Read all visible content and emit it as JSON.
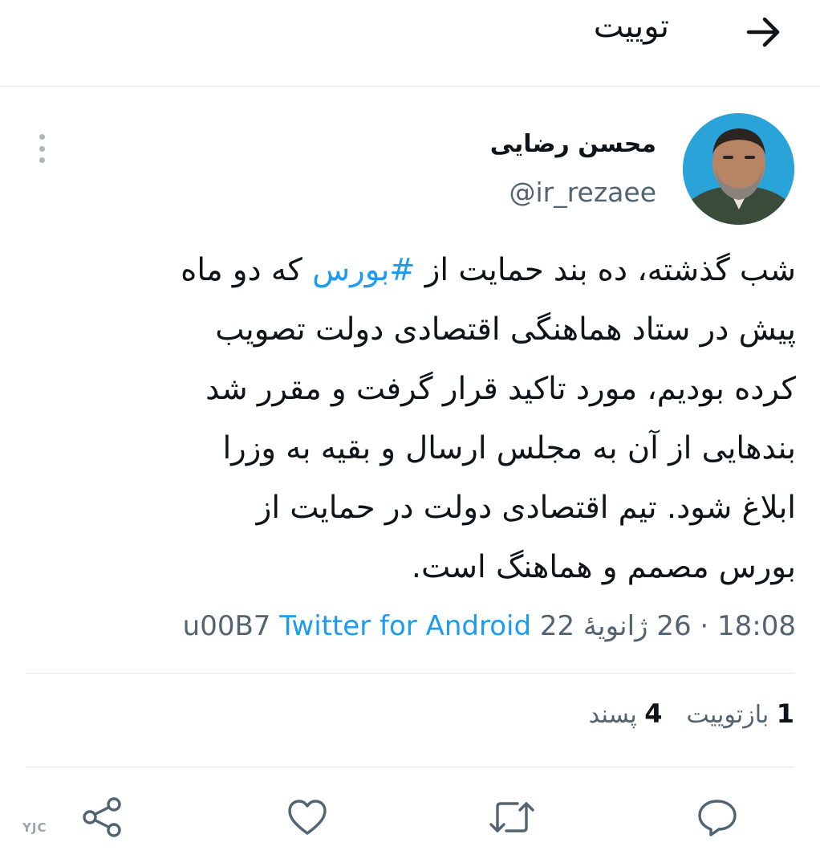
{
  "header": {
    "title": "توییت",
    "back_icon": "arrow-right-icon"
  },
  "author": {
    "name": "محسن رضایی",
    "handle": "@ir_rezaee",
    "avatar_bg": "#2aa3d8"
  },
  "tweet": {
    "line1_pre": "شب گذشته، ده بند حمایت از ",
    "hashtag": "#بورس",
    "line1_post": " که دو ماه",
    "line2": "پیش در ستاد هماهنگی اقتصادی دولت تصویب",
    "line3": "کرده بودیم، مورد تاکید قرار گرفت و مقرر شد",
    "line4": "بندهایی از آن به مجلس ارسال و بقیه به وزرا",
    "line5": "ابلاغ شود. تیم اقتصادی دولت در حمایت از",
    "line6": "بورس مصمم و هماهنگ است."
  },
  "meta": {
    "time": "18:08",
    "separator": "·",
    "date": "26 ژانویهٔ 22",
    "glyph": "u00B7",
    "source": "Twitter for Android"
  },
  "stats": {
    "retweets_count": "1",
    "retweets_label": "بازتوییت",
    "likes_count": "4",
    "likes_label": "پسند"
  },
  "actions": {
    "reply_icon": "reply-icon",
    "retweet_icon": "retweet-icon",
    "like_icon": "heart-icon",
    "share_icon": "share-icon"
  },
  "colors": {
    "accent": "#1d9bf0",
    "secondary_text": "#536471",
    "icon": "#536471"
  },
  "watermark": "YJC"
}
